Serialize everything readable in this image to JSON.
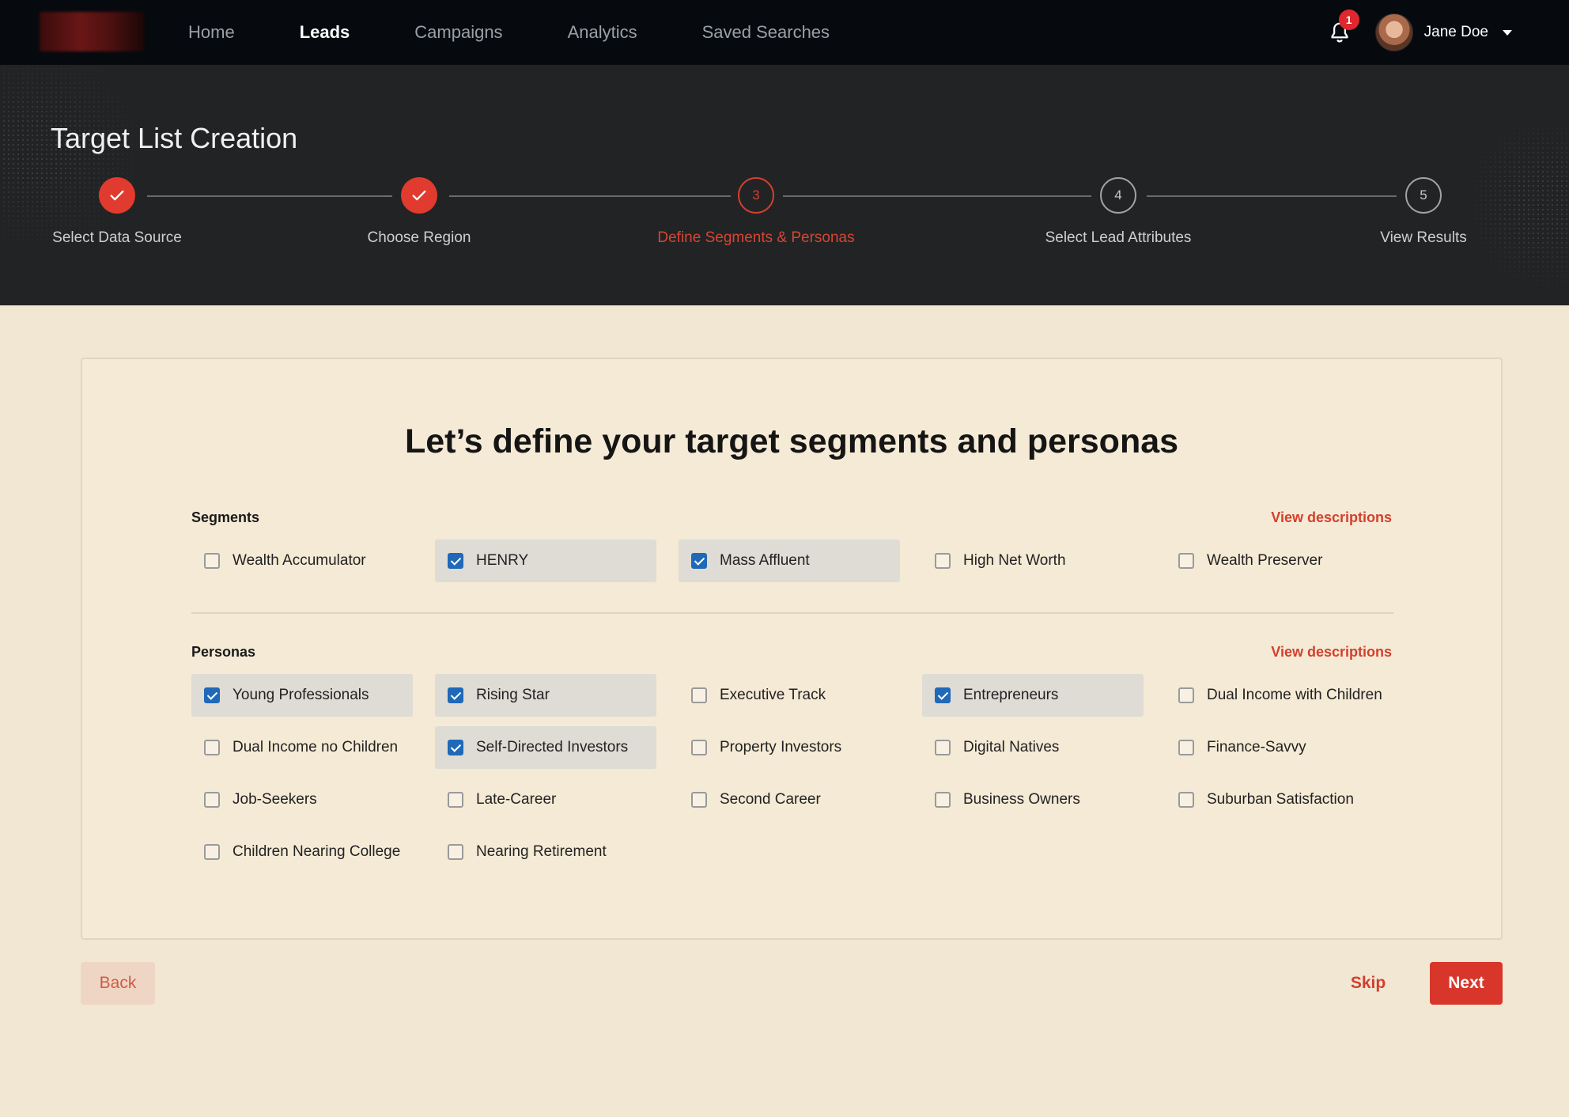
{
  "nav": {
    "links": [
      {
        "label": "Home",
        "active": false
      },
      {
        "label": "Leads",
        "active": true
      },
      {
        "label": "Campaigns",
        "active": false
      },
      {
        "label": "Analytics",
        "active": false
      },
      {
        "label": "Saved Searches",
        "active": false
      }
    ],
    "notification_count": "1",
    "user_name": "Jane Doe",
    "icons": {
      "notifications": "bell-icon",
      "menu": "chevron-down-icon"
    }
  },
  "hero": {
    "title": "Target List Creation",
    "steps": [
      {
        "label": "Select Data Source",
        "number": "1",
        "state": "done"
      },
      {
        "label": "Choose Region",
        "number": "2",
        "state": "done"
      },
      {
        "label": "Define Segments & Personas",
        "number": "3",
        "state": "current"
      },
      {
        "label": "Select Lead Attributes",
        "number": "4",
        "state": "todo"
      },
      {
        "label": "View Results",
        "number": "5",
        "state": "todo"
      }
    ]
  },
  "card": {
    "title": "Let’s define your target segments and personas",
    "segments": {
      "label": "Segments",
      "view_descriptions": "View descriptions",
      "options": [
        {
          "label": "Wealth Accumulator",
          "checked": false
        },
        {
          "label": "HENRY",
          "checked": true
        },
        {
          "label": "Mass Affluent",
          "checked": true
        },
        {
          "label": "High Net Worth",
          "checked": false
        },
        {
          "label": "Wealth Preserver",
          "checked": false
        }
      ]
    },
    "personas": {
      "label": "Personas",
      "view_descriptions": "View descriptions",
      "options": [
        {
          "label": "Young Professionals",
          "checked": true
        },
        {
          "label": "Rising Star",
          "checked": true
        },
        {
          "label": "Executive Track",
          "checked": false
        },
        {
          "label": "Entrepreneurs",
          "checked": true
        },
        {
          "label": "Dual Income with Children",
          "checked": false
        },
        {
          "label": "Dual Income no Children",
          "checked": false
        },
        {
          "label": "Self-Directed Investors",
          "checked": true
        },
        {
          "label": "Property Investors",
          "checked": false
        },
        {
          "label": "Digital Natives",
          "checked": false
        },
        {
          "label": "Finance-Savvy",
          "checked": false
        },
        {
          "label": "Job-Seekers",
          "checked": false
        },
        {
          "label": "Late-Career",
          "checked": false
        },
        {
          "label": "Second Career",
          "checked": false
        },
        {
          "label": "Business Owners",
          "checked": false
        },
        {
          "label": "Suburban Satisfaction",
          "checked": false
        },
        {
          "label": "Children Nearing College",
          "checked": false
        },
        {
          "label": "Nearing Retirement",
          "checked": false
        }
      ]
    }
  },
  "footer": {
    "back_label": "Back",
    "skip_label": "Skip",
    "next_label": "Next"
  },
  "colors": {
    "accent": "#d8362a",
    "checkbox_checked": "#1f69b8",
    "nav_bg": "#060a0e",
    "hero_bg": "#222324",
    "page_bg": "#f1e7d3"
  }
}
